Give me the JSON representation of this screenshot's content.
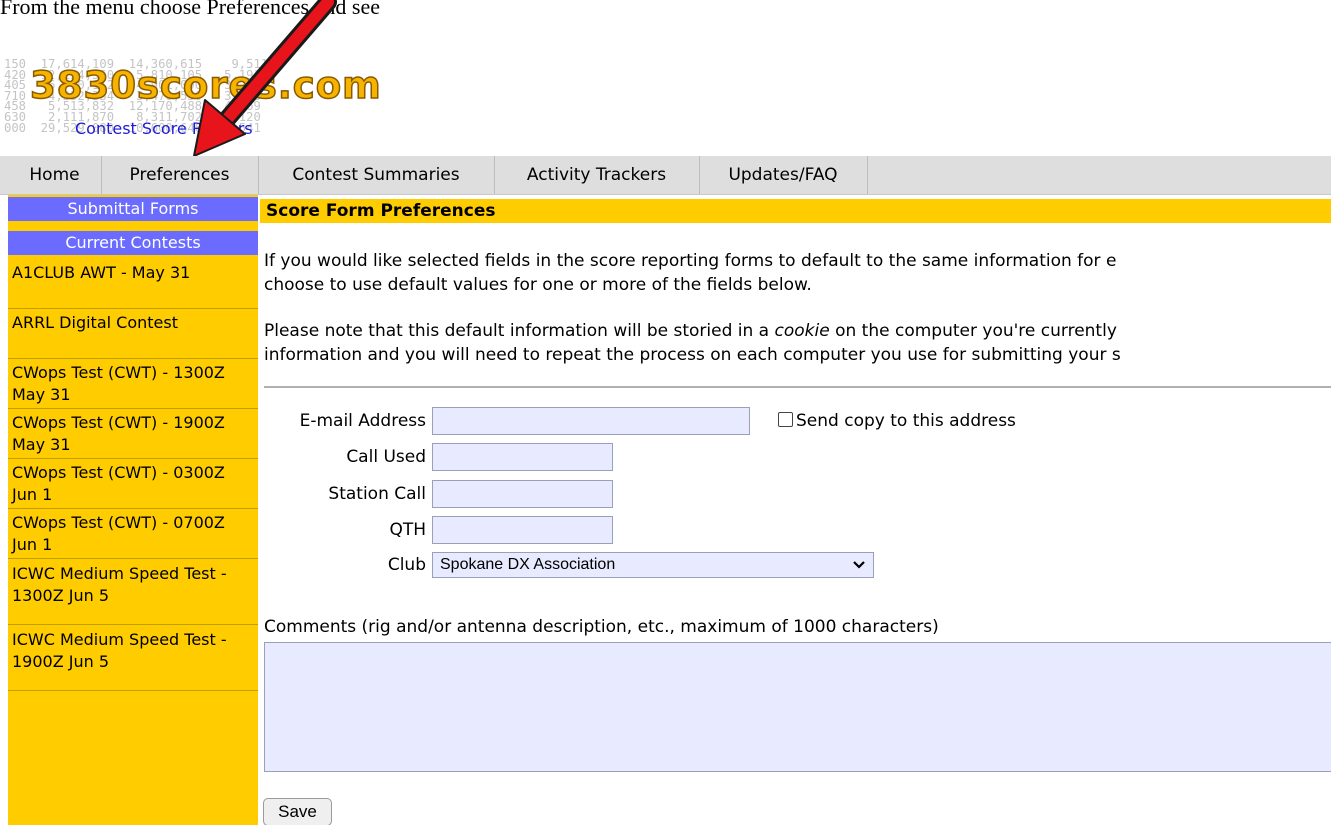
{
  "caption": "From the menu choose Preferences and see",
  "logo": {
    "site_name": "3830scores.com",
    "link_text": "Contest Score Rumors",
    "background_numbers": "150  17,614,109  14,360,615    9,511\n420  12,134,360   5,810,105   5,191\n405   6,710,112   4,901,000   3,296\n710   4,352,334   3,470,550   3,656\n458   5,513,832  12,170,488   4,069\n630   2,111,870   8,311,702   1,120\n000  29,529,080  10,600,646  14,541"
  },
  "nav": {
    "home": "Home",
    "preferences": "Preferences",
    "contest_summaries": "Contest Summaries",
    "activity_trackers": "Activity Trackers",
    "updates_faq": "Updates/FAQ"
  },
  "sidebar": {
    "submittal_forms": "Submittal Forms",
    "current_contests": "Current Contests",
    "contests": [
      "A1CLUB AWT - May 31",
      "ARRL Digital Contest",
      "CWops Test (CWT) - 1300Z May 31",
      "CWops Test (CWT) - 1900Z May 31",
      "CWops Test (CWT) - 0300Z Jun 1",
      "CWops Test (CWT) - 0700Z Jun 1",
      "ICWC Medium Speed Test - 1300Z Jun 5",
      "ICWC Medium Speed Test - 1900Z Jun 5"
    ]
  },
  "main": {
    "section_title": "Score Form Preferences",
    "para1": {
      "line1": "If you would like selected fields in the score reporting forms to default to the same information for e",
      "line2": "choose to use default values for one or more of the fields below."
    },
    "para2": {
      "line1_pre": "Please note that this default information will be storied in a ",
      "line1_em": "cookie",
      "line1_post": " on the computer you're currently",
      "line2": "information and you will need to repeat the process on each computer you use for submitting your s"
    }
  },
  "form": {
    "email_label": "E-mail Address",
    "email_value": "",
    "send_copy_label": "Send copy to this address",
    "send_copy_checked": false,
    "call_used_label": "Call Used",
    "call_used_value": "",
    "station_call_label": "Station Call",
    "station_call_value": "",
    "qth_label": "QTH",
    "qth_value": "",
    "club_label": "Club",
    "club_value": "Spokane DX Association",
    "comments_label": "Comments (rig and/or antenna description, etc., maximum of 1000 characters)",
    "comments_value": "",
    "save_label": "Save"
  },
  "colors": {
    "sidebar_bg": "#ffcc00",
    "sidebar_header_bg": "#6b6bff",
    "nav_bg": "#dedede",
    "input_bg": "#e8eaff",
    "link": "#1d1ad6",
    "arrow": "#e8141b"
  }
}
